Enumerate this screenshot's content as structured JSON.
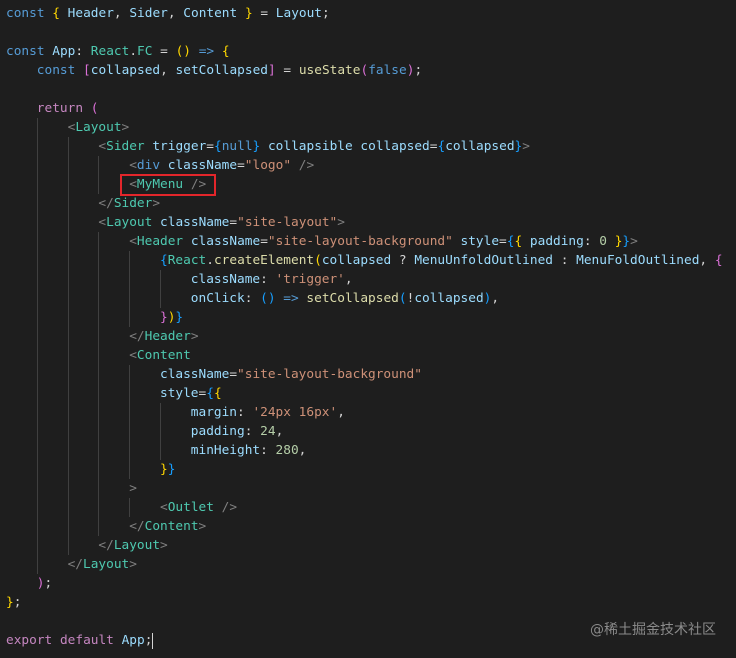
{
  "editor": {
    "lines": [
      [
        [
          "const",
          "k"
        ],
        [
          " ",
          "p"
        ],
        [
          "{",
          "y"
        ],
        [
          " Header",
          "v"
        ],
        [
          ", ",
          "p"
        ],
        [
          "Sider",
          "v"
        ],
        [
          ", ",
          "p"
        ],
        [
          "Content",
          "v"
        ],
        [
          " ",
          "p"
        ],
        [
          "}",
          "y"
        ],
        [
          " = ",
          "p"
        ],
        [
          "Layout",
          "v"
        ],
        [
          ";",
          "p"
        ]
      ],
      [],
      [
        [
          "const",
          "k"
        ],
        [
          " App",
          "v"
        ],
        [
          ": ",
          "p"
        ],
        [
          "React",
          "t"
        ],
        [
          ".",
          "p"
        ],
        [
          "FC",
          "t"
        ],
        [
          " = ",
          "p"
        ],
        [
          "()",
          "y"
        ],
        [
          " ",
          "p"
        ],
        [
          "=>",
          "k"
        ],
        [
          " ",
          "p"
        ],
        [
          "{",
          "y"
        ]
      ],
      [
        [
          "    ",
          "i"
        ],
        [
          "const",
          "k"
        ],
        [
          " ",
          "p"
        ],
        [
          "[",
          "m"
        ],
        [
          "collapsed",
          "v"
        ],
        [
          ", ",
          "p"
        ],
        [
          "setCollapsed",
          "v"
        ],
        [
          "]",
          "m"
        ],
        [
          " = ",
          "p"
        ],
        [
          "useState",
          "f"
        ],
        [
          "(",
          "m"
        ],
        [
          "false",
          "k"
        ],
        [
          ")",
          "m"
        ],
        [
          ";",
          "p"
        ]
      ],
      [],
      [
        [
          "    ",
          "i"
        ],
        [
          "return",
          "r"
        ],
        [
          " ",
          "p"
        ],
        [
          "(",
          "m"
        ]
      ],
      [
        [
          "        ",
          "i"
        ],
        [
          "<",
          "g"
        ],
        [
          "Layout",
          "t"
        ],
        [
          ">",
          "g"
        ]
      ],
      [
        [
          "            ",
          "i"
        ],
        [
          "<",
          "g"
        ],
        [
          "Sider",
          "t"
        ],
        [
          " trigger",
          "v"
        ],
        [
          "=",
          "p"
        ],
        [
          "{",
          "b"
        ],
        [
          "null",
          "k"
        ],
        [
          "}",
          "b"
        ],
        [
          " collapsible",
          "v"
        ],
        [
          " collapsed",
          "v"
        ],
        [
          "=",
          "p"
        ],
        [
          "{",
          "b"
        ],
        [
          "collapsed",
          "v"
        ],
        [
          "}",
          "b"
        ],
        [
          ">",
          "g"
        ]
      ],
      [
        [
          "                ",
          "i"
        ],
        [
          "<",
          "g"
        ],
        [
          "div",
          "k"
        ],
        [
          " className",
          "v"
        ],
        [
          "=",
          "p"
        ],
        [
          "\"logo\"",
          "s"
        ],
        [
          " />",
          "g"
        ]
      ],
      [
        [
          "                ",
          "i"
        ],
        [
          "<",
          "g"
        ],
        [
          "MyMenu",
          "t"
        ],
        [
          " />",
          "g"
        ]
      ],
      [
        [
          "            ",
          "i"
        ],
        [
          "</",
          "g"
        ],
        [
          "Sider",
          "t"
        ],
        [
          ">",
          "g"
        ]
      ],
      [
        [
          "            ",
          "i"
        ],
        [
          "<",
          "g"
        ],
        [
          "Layout",
          "t"
        ],
        [
          " className",
          "v"
        ],
        [
          "=",
          "p"
        ],
        [
          "\"site-layout\"",
          "s"
        ],
        [
          ">",
          "g"
        ]
      ],
      [
        [
          "                ",
          "i"
        ],
        [
          "<",
          "g"
        ],
        [
          "Header",
          "t"
        ],
        [
          " className",
          "v"
        ],
        [
          "=",
          "p"
        ],
        [
          "\"site-layout-background\"",
          "s"
        ],
        [
          " style",
          "v"
        ],
        [
          "=",
          "p"
        ],
        [
          "{",
          "b"
        ],
        [
          "{",
          "y"
        ],
        [
          " padding",
          "v"
        ],
        [
          ": ",
          "p"
        ],
        [
          "0",
          "n"
        ],
        [
          " ",
          "p"
        ],
        [
          "}",
          "y"
        ],
        [
          "}",
          "b"
        ],
        [
          ">",
          "g"
        ]
      ],
      [
        [
          "                    ",
          "i"
        ],
        [
          "{",
          "b"
        ],
        [
          "React",
          "t"
        ],
        [
          ".",
          "p"
        ],
        [
          "createElement",
          "f"
        ],
        [
          "(",
          "y"
        ],
        [
          "collapsed",
          "v"
        ],
        [
          " ? ",
          "p"
        ],
        [
          "MenuUnfoldOutlined",
          "v"
        ],
        [
          " : ",
          "p"
        ],
        [
          "MenuFoldOutlined",
          "v"
        ],
        [
          ", ",
          "p"
        ],
        [
          "{",
          "m"
        ]
      ],
      [
        [
          "                        ",
          "i"
        ],
        [
          "className",
          "v"
        ],
        [
          ": ",
          "p"
        ],
        [
          "'trigger'",
          "s"
        ],
        [
          ",",
          "p"
        ]
      ],
      [
        [
          "                        ",
          "i"
        ],
        [
          "onClick",
          "v"
        ],
        [
          ": ",
          "p"
        ],
        [
          "()",
          "b"
        ],
        [
          " ",
          "p"
        ],
        [
          "=>",
          "k"
        ],
        [
          " ",
          "p"
        ],
        [
          "setCollapsed",
          "f"
        ],
        [
          "(",
          "b"
        ],
        [
          "!",
          "p"
        ],
        [
          "collapsed",
          "v"
        ],
        [
          ")",
          "b"
        ],
        [
          ",",
          "p"
        ]
      ],
      [
        [
          "                    ",
          "i"
        ],
        [
          "}",
          "m"
        ],
        [
          ")",
          "y"
        ],
        [
          "}",
          "b"
        ]
      ],
      [
        [
          "                ",
          "i"
        ],
        [
          "</",
          "g"
        ],
        [
          "Header",
          "t"
        ],
        [
          ">",
          "g"
        ]
      ],
      [
        [
          "                ",
          "i"
        ],
        [
          "<",
          "g"
        ],
        [
          "Content",
          "t"
        ]
      ],
      [
        [
          "                    ",
          "i"
        ],
        [
          "className",
          "v"
        ],
        [
          "=",
          "p"
        ],
        [
          "\"site-layout-background\"",
          "s"
        ]
      ],
      [
        [
          "                    ",
          "i"
        ],
        [
          "style",
          "v"
        ],
        [
          "=",
          "p"
        ],
        [
          "{",
          "b"
        ],
        [
          "{",
          "y"
        ]
      ],
      [
        [
          "                        ",
          "i"
        ],
        [
          "margin",
          "v"
        ],
        [
          ": ",
          "p"
        ],
        [
          "'24px 16px'",
          "s"
        ],
        [
          ",",
          "p"
        ]
      ],
      [
        [
          "                        ",
          "i"
        ],
        [
          "padding",
          "v"
        ],
        [
          ": ",
          "p"
        ],
        [
          "24",
          "n"
        ],
        [
          ",",
          "p"
        ]
      ],
      [
        [
          "                        ",
          "i"
        ],
        [
          "minHeight",
          "v"
        ],
        [
          ": ",
          "p"
        ],
        [
          "280",
          "n"
        ],
        [
          ",",
          "p"
        ]
      ],
      [
        [
          "                    ",
          "i"
        ],
        [
          "}",
          "y"
        ],
        [
          "}",
          "b"
        ]
      ],
      [
        [
          "                ",
          "i"
        ],
        [
          ">",
          "g"
        ]
      ],
      [
        [
          "                    ",
          "i"
        ],
        [
          "<",
          "g"
        ],
        [
          "Outlet",
          "t"
        ],
        [
          " />",
          "g"
        ]
      ],
      [
        [
          "                ",
          "i"
        ],
        [
          "</",
          "g"
        ],
        [
          "Content",
          "t"
        ],
        [
          ">",
          "g"
        ]
      ],
      [
        [
          "            ",
          "i"
        ],
        [
          "</",
          "g"
        ],
        [
          "Layout",
          "t"
        ],
        [
          ">",
          "g"
        ]
      ],
      [
        [
          "        ",
          "i"
        ],
        [
          "</",
          "g"
        ],
        [
          "Layout",
          "t"
        ],
        [
          ">",
          "g"
        ]
      ],
      [
        [
          "    ",
          "i"
        ],
        [
          ")",
          "m"
        ],
        [
          ";",
          "p"
        ]
      ],
      [
        [
          "}",
          "y"
        ],
        [
          ";",
          "p"
        ]
      ],
      [],
      [
        [
          "export",
          "r"
        ],
        [
          " ",
          "p"
        ],
        [
          "default",
          "r"
        ],
        [
          " App",
          "v"
        ],
        [
          ";",
          "p"
        ]
      ]
    ]
  },
  "watermark": "@稀土掘金技术社区"
}
